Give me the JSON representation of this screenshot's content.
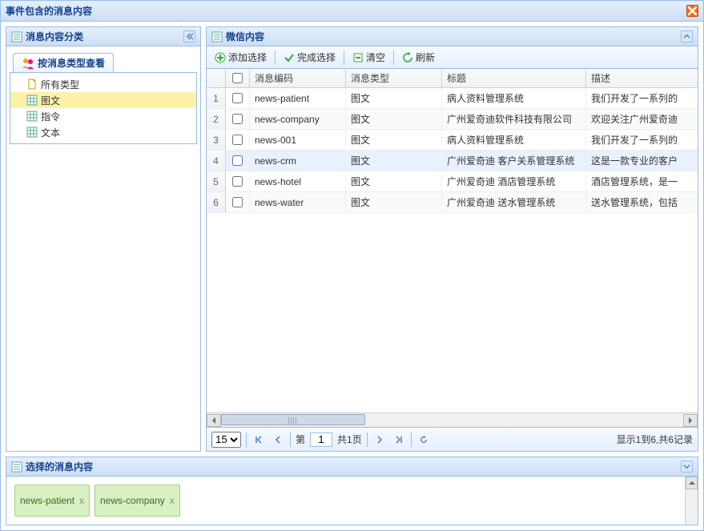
{
  "window": {
    "title": "事件包含的消息内容"
  },
  "left_panel": {
    "title": "消息内容分类",
    "tab_label": "按消息类型查看",
    "items": [
      {
        "label": "所有类型",
        "icon": "page"
      },
      {
        "label": "图文",
        "icon": "grid",
        "selected": true
      },
      {
        "label": "指令",
        "icon": "grid"
      },
      {
        "label": "文本",
        "icon": "grid"
      }
    ]
  },
  "right_panel": {
    "title": "微信内容",
    "toolbar": {
      "add_label": "添加选择",
      "done_label": "完成选择",
      "clear_label": "清空",
      "refresh_label": "刷新"
    },
    "columns": {
      "code": "消息编码",
      "type": "消息类型",
      "title": "标题",
      "desc": "描述"
    },
    "rows": [
      {
        "idx": "1",
        "code": "news-patient",
        "type": "图文",
        "title": "病人资料管理系统",
        "desc": "我们开发了一系列的"
      },
      {
        "idx": "2",
        "code": "news-company",
        "type": "图文",
        "title": "广州爱奇迪软件科技有限公司",
        "desc": "欢迎关注广州爱奇迪"
      },
      {
        "idx": "3",
        "code": "news-001",
        "type": "图文",
        "title": "病人资料管理系统",
        "desc": "我们开发了一系列的"
      },
      {
        "idx": "4",
        "code": "news-crm",
        "type": "图文",
        "title": "广州爱奇迪 客户关系管理系统",
        "desc": "这是一款专业的客户",
        "hover": true
      },
      {
        "idx": "5",
        "code": "news-hotel",
        "type": "图文",
        "title": "广州爱奇迪 酒店管理系统",
        "desc": "酒店管理系统，是一"
      },
      {
        "idx": "6",
        "code": "news-water",
        "type": "图文",
        "title": "广州爱奇迪 送水管理系统",
        "desc": "送水管理系统，包括"
      }
    ],
    "pager": {
      "page_size": "15",
      "page_label_prefix": "第",
      "page_value": "1",
      "total_pages_label": "共1页",
      "display_label": "显示1到6,共6记录"
    }
  },
  "bottom_panel": {
    "title": "选择的消息内容",
    "tags": [
      {
        "label": "news-patient"
      },
      {
        "label": "news-company"
      }
    ]
  },
  "icons": {
    "close_x": "x"
  }
}
